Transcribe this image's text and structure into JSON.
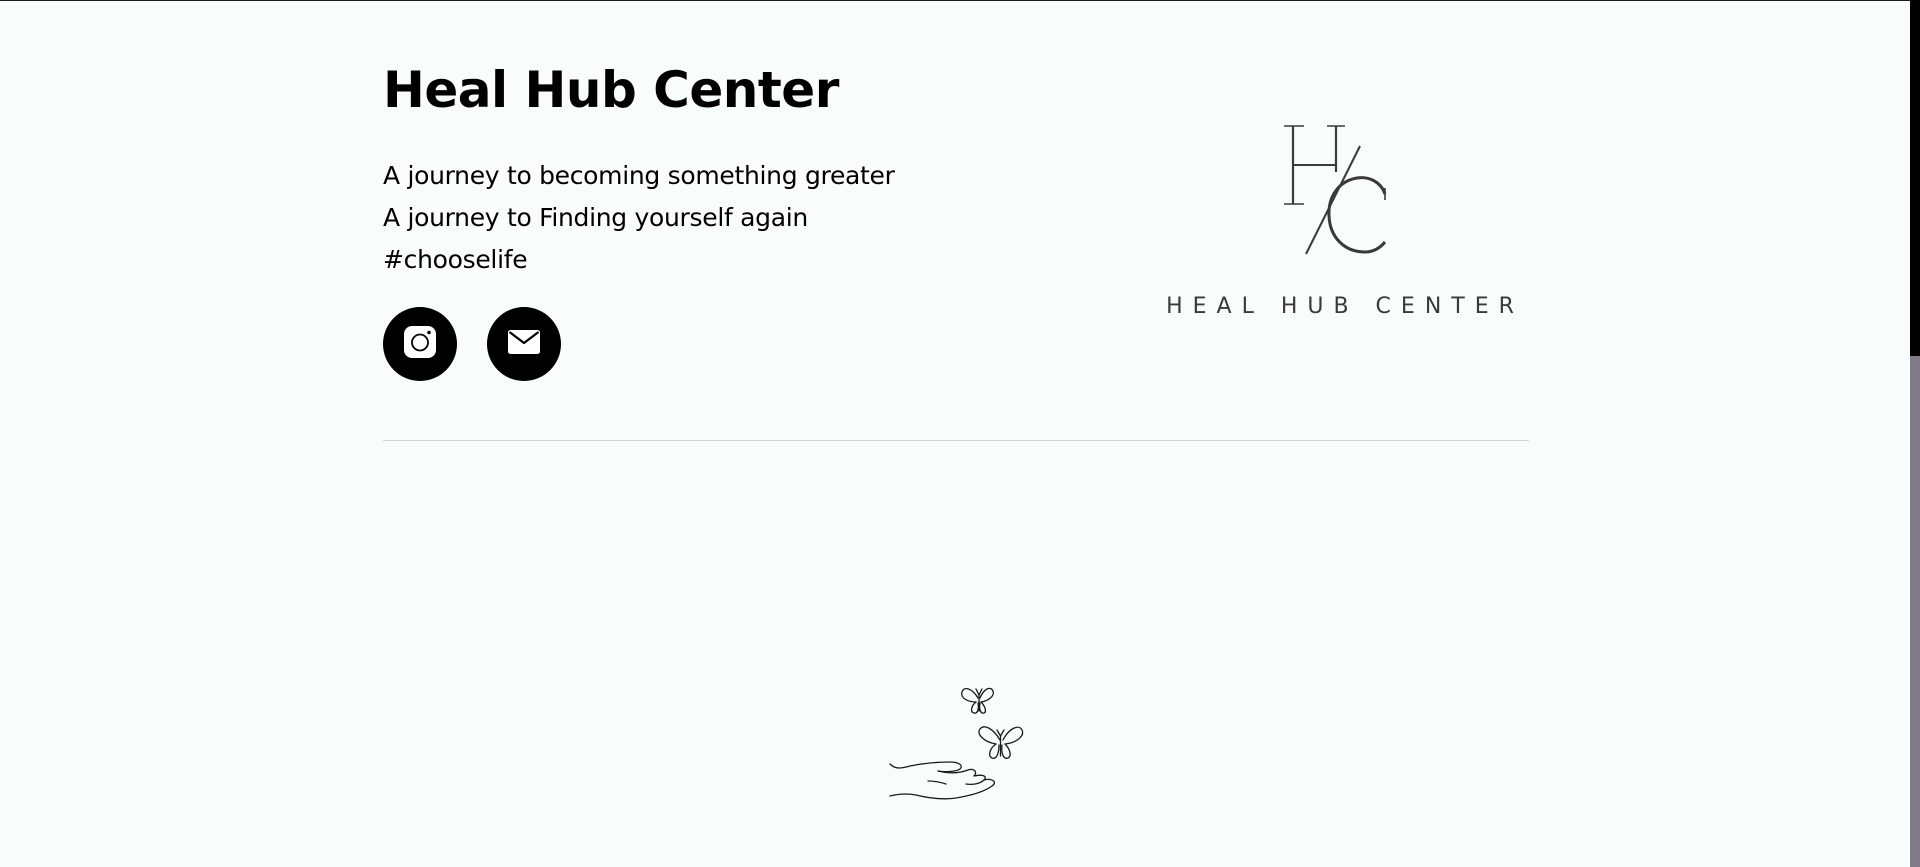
{
  "header": {
    "title": "Heal Hub Center",
    "tagline_lines": [
      "A journey to becoming something greater",
      "A journey to Finding yourself again",
      "#chooselife"
    ]
  },
  "socials": [
    {
      "name": "instagram",
      "icon": "instagram-icon"
    },
    {
      "name": "email",
      "icon": "mail-icon"
    }
  ],
  "logo": {
    "monogram": "H/C",
    "wordmark": "HEAL HUB CENTER"
  },
  "illustration": {
    "icon": "hand-butterflies-icon"
  },
  "colors": {
    "background": "#f8fcfb",
    "text": "#000000",
    "logo": "#3a3a3a",
    "divider": "#cfd3d3",
    "scrollbar_track": "#000000",
    "scrollbar_thumb": "#7f7b87"
  }
}
